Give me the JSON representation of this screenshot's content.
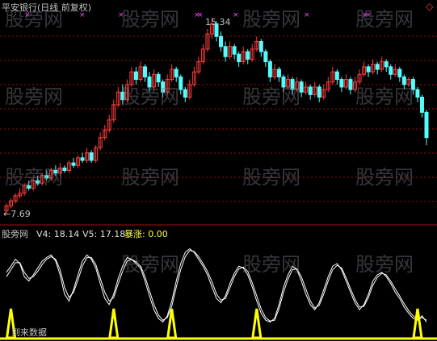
{
  "title": "平安银行(日线 前复权)",
  "price_high_label": "15.34",
  "price_low_label": "←7.69",
  "indicator": {
    "name": "股旁网",
    "v4_label": "V4: 18.14",
    "v5_label": "V5: 17.18",
    "burst_label": "暴涨: 0.00",
    "bottom_text": "到来数据"
  },
  "watermark": "股旁网",
  "colors": {
    "up": "#ff3c3c",
    "down": "#54fcfc",
    "grid": "#a01010",
    "title": "#c0c0c0",
    "marker": "#ff44ff",
    "v4": "#ffffff",
    "v5": "#ffffff",
    "burst": "#ffff00"
  },
  "icons": [
    "close-diamond-icon"
  ],
  "chart_data": {
    "type": "candlestick",
    "ylim": [
      7.69,
      15.34
    ],
    "candles": [
      [
        7.7,
        7.9,
        7.6,
        8.0
      ],
      [
        7.9,
        8.1,
        7.8,
        8.2
      ],
      [
        8.1,
        8.3,
        8.0,
        8.4
      ],
      [
        8.3,
        8.4,
        8.2,
        8.6
      ],
      [
        8.4,
        8.7,
        8.3,
        8.8
      ],
      [
        8.7,
        8.6,
        8.5,
        8.9
      ],
      [
        8.6,
        8.9,
        8.5,
        9.0
      ],
      [
        8.9,
        8.8,
        8.7,
        9.1
      ],
      [
        8.8,
        9.1,
        8.7,
        9.2
      ],
      [
        9.1,
        9.0,
        8.9,
        9.3
      ],
      [
        9.0,
        9.3,
        8.9,
        9.4
      ],
      [
        9.3,
        9.2,
        9.1,
        9.5
      ],
      [
        9.2,
        9.4,
        9.1,
        9.6
      ],
      [
        9.4,
        9.3,
        9.2,
        9.5
      ],
      [
        9.3,
        9.6,
        9.2,
        9.7
      ],
      [
        9.6,
        9.5,
        9.4,
        9.8
      ],
      [
        9.5,
        9.8,
        9.4,
        9.9
      ],
      [
        9.8,
        9.7,
        9.6,
        10.0
      ],
      [
        9.7,
        10.0,
        9.6,
        10.2
      ],
      [
        10.0,
        9.7,
        9.6,
        10.1
      ],
      [
        9.7,
        10.2,
        9.6,
        10.3
      ],
      [
        10.2,
        10.6,
        10.1,
        10.8
      ],
      [
        10.6,
        10.9,
        10.5,
        11.1
      ],
      [
        10.9,
        11.3,
        10.8,
        11.5
      ],
      [
        11.3,
        11.9,
        11.2,
        12.1
      ],
      [
        11.9,
        12.4,
        11.8,
        12.6
      ],
      [
        12.4,
        12.1,
        11.9,
        12.7
      ],
      [
        12.1,
        12.7,
        12.0,
        12.9
      ],
      [
        12.7,
        13.2,
        12.6,
        13.4
      ],
      [
        13.2,
        12.9,
        12.7,
        13.4
      ],
      [
        12.9,
        13.4,
        12.8,
        13.6
      ],
      [
        13.4,
        13.0,
        12.8,
        13.5
      ],
      [
        13.0,
        12.6,
        12.4,
        13.2
      ],
      [
        12.6,
        13.1,
        12.5,
        13.3
      ],
      [
        13.1,
        12.8,
        12.6,
        13.2
      ],
      [
        12.8,
        12.4,
        12.2,
        12.9
      ],
      [
        12.4,
        12.9,
        12.3,
        13.1
      ],
      [
        12.9,
        13.3,
        12.8,
        13.5
      ],
      [
        13.3,
        13.0,
        12.8,
        13.4
      ],
      [
        13.0,
        12.5,
        12.3,
        13.1
      ],
      [
        12.5,
        12.2,
        12.0,
        12.6
      ],
      [
        12.2,
        12.7,
        12.1,
        12.9
      ],
      [
        12.7,
        13.2,
        12.6,
        13.4
      ],
      [
        13.2,
        13.6,
        13.1,
        13.8
      ],
      [
        13.6,
        14.1,
        13.5,
        14.3
      ],
      [
        14.1,
        14.7,
        14.0,
        14.9
      ],
      [
        14.7,
        15.1,
        14.5,
        15.34
      ],
      [
        15.1,
        14.6,
        14.4,
        15.2
      ],
      [
        14.6,
        14.2,
        14.0,
        14.8
      ],
      [
        14.2,
        13.8,
        13.6,
        14.4
      ],
      [
        13.8,
        14.2,
        13.7,
        14.4
      ],
      [
        14.2,
        13.9,
        13.7,
        14.3
      ],
      [
        13.9,
        13.6,
        13.4,
        14.0
      ],
      [
        13.6,
        14.0,
        13.5,
        14.2
      ],
      [
        14.0,
        13.7,
        13.5,
        14.1
      ],
      [
        13.7,
        14.1,
        13.6,
        14.3
      ],
      [
        14.1,
        14.4,
        14.0,
        14.6
      ],
      [
        14.4,
        14.0,
        13.8,
        14.5
      ],
      [
        14.0,
        13.6,
        13.4,
        14.1
      ],
      [
        13.6,
        13.0,
        12.8,
        13.7
      ],
      [
        13.0,
        13.3,
        12.9,
        13.5
      ],
      [
        13.3,
        13.0,
        12.8,
        13.4
      ],
      [
        13.0,
        12.6,
        12.4,
        13.1
      ],
      [
        12.6,
        12.9,
        12.5,
        13.1
      ],
      [
        12.9,
        12.5,
        12.3,
        13.0
      ],
      [
        12.5,
        12.8,
        12.4,
        13.0
      ],
      [
        12.8,
        12.4,
        12.2,
        12.9
      ],
      [
        12.4,
        12.6,
        12.3,
        12.8
      ],
      [
        12.6,
        12.3,
        12.1,
        12.7
      ],
      [
        12.3,
        12.6,
        12.2,
        12.8
      ],
      [
        12.6,
        12.2,
        12.0,
        12.7
      ],
      [
        12.2,
        12.5,
        12.1,
        12.7
      ],
      [
        12.5,
        12.8,
        12.4,
        13.0
      ],
      [
        12.8,
        13.2,
        12.7,
        13.4
      ],
      [
        13.2,
        12.9,
        12.7,
        13.3
      ],
      [
        12.9,
        12.6,
        12.4,
        13.0
      ],
      [
        12.6,
        12.9,
        12.5,
        13.1
      ],
      [
        12.9,
        12.5,
        12.3,
        13.0
      ],
      [
        12.5,
        12.8,
        12.4,
        13.0
      ],
      [
        12.8,
        13.1,
        12.7,
        13.3
      ],
      [
        13.1,
        13.4,
        13.0,
        13.6
      ],
      [
        13.4,
        13.2,
        13.0,
        13.5
      ],
      [
        13.2,
        13.5,
        13.1,
        13.7
      ],
      [
        13.5,
        13.3,
        13.1,
        13.6
      ],
      [
        13.3,
        13.6,
        13.2,
        13.8
      ],
      [
        13.6,
        13.4,
        13.2,
        13.7
      ],
      [
        13.4,
        13.1,
        12.9,
        13.5
      ],
      [
        13.1,
        13.3,
        13.0,
        13.5
      ],
      [
        13.3,
        13.0,
        12.8,
        13.4
      ],
      [
        13.0,
        12.7,
        12.5,
        13.1
      ],
      [
        12.7,
        12.9,
        12.6,
        13.0
      ],
      [
        12.9,
        12.5,
        12.3,
        13.0
      ],
      [
        12.5,
        12.2,
        12.0,
        12.6
      ],
      [
        12.2,
        11.6,
        11.4,
        12.3
      ],
      [
        11.6,
        10.6,
        10.3,
        11.7
      ]
    ],
    "indicator_v4": [
      0.65,
      0.72,
      0.8,
      0.75,
      0.6,
      0.55,
      0.62,
      0.7,
      0.78,
      0.82,
      0.85,
      0.78,
      0.62,
      0.4,
      0.32,
      0.45,
      0.62,
      0.78,
      0.85,
      0.8,
      0.7,
      0.52,
      0.35,
      0.28,
      0.4,
      0.58,
      0.72,
      0.82,
      0.8,
      0.75,
      0.7,
      0.55,
      0.38,
      0.22,
      0.12,
      0.08,
      0.15,
      0.32,
      0.55,
      0.75,
      0.88,
      0.92,
      0.88,
      0.8,
      0.72,
      0.62,
      0.48,
      0.35,
      0.3,
      0.38,
      0.52,
      0.64,
      0.72,
      0.7,
      0.62,
      0.48,
      0.32,
      0.18,
      0.1,
      0.08,
      0.12,
      0.28,
      0.48,
      0.62,
      0.72,
      0.68,
      0.55,
      0.4,
      0.28,
      0.22,
      0.3,
      0.45,
      0.6,
      0.72,
      0.75,
      0.68,
      0.55,
      0.42,
      0.3,
      0.22,
      0.28,
      0.4,
      0.55,
      0.62,
      0.65,
      0.6,
      0.52,
      0.42,
      0.35,
      0.25,
      0.18,
      0.12,
      0.1,
      0.15,
      0.08
    ],
    "indicator_v5": [
      0.6,
      0.68,
      0.76,
      0.76,
      0.65,
      0.58,
      0.6,
      0.66,
      0.74,
      0.8,
      0.83,
      0.8,
      0.68,
      0.48,
      0.36,
      0.42,
      0.56,
      0.72,
      0.82,
      0.82,
      0.74,
      0.58,
      0.42,
      0.32,
      0.36,
      0.52,
      0.66,
      0.78,
      0.8,
      0.77,
      0.72,
      0.6,
      0.44,
      0.28,
      0.16,
      0.1,
      0.13,
      0.26,
      0.48,
      0.68,
      0.83,
      0.9,
      0.89,
      0.83,
      0.75,
      0.66,
      0.54,
      0.4,
      0.33,
      0.35,
      0.47,
      0.6,
      0.69,
      0.71,
      0.66,
      0.53,
      0.38,
      0.23,
      0.13,
      0.09,
      0.1,
      0.23,
      0.42,
      0.57,
      0.68,
      0.69,
      0.6,
      0.46,
      0.32,
      0.24,
      0.27,
      0.4,
      0.55,
      0.68,
      0.73,
      0.7,
      0.59,
      0.46,
      0.34,
      0.25,
      0.26,
      0.36,
      0.5,
      0.59,
      0.64,
      0.62,
      0.55,
      0.46,
      0.38,
      0.29,
      0.21,
      0.15,
      0.11,
      0.13,
      0.1
    ],
    "burst_peaks": [
      1,
      24,
      37,
      56,
      92
    ]
  }
}
